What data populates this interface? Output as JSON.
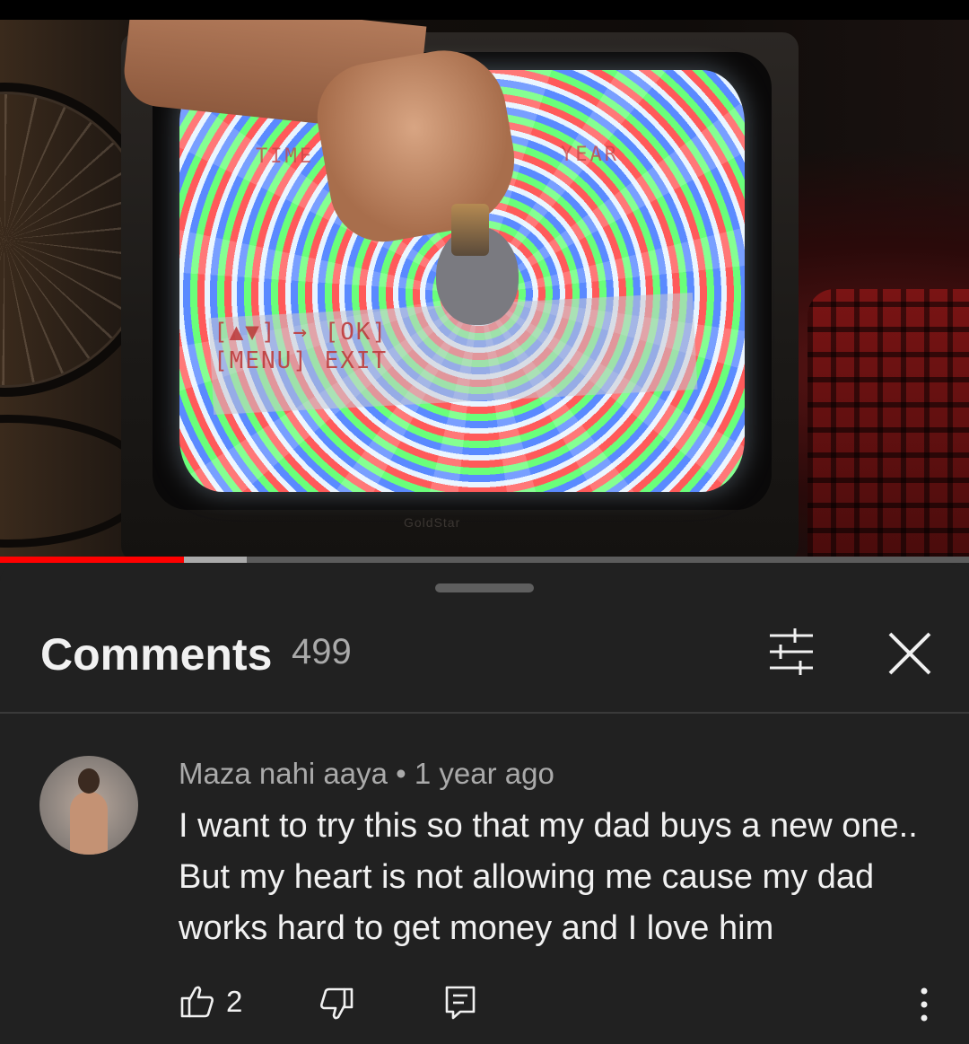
{
  "video": {
    "tv_osd": {
      "line1": "[▲▼] → [OK]",
      "line2": "[MENU] EXIT",
      "top_left": "TIME",
      "top_right": "YEAR"
    },
    "tv_brand": "GoldStar",
    "progress": {
      "played_fraction": 0.19,
      "buffered_fraction": 0.255
    }
  },
  "comments_panel": {
    "title": "Comments",
    "count": "499",
    "icons": {
      "filter": "sort-filter-icon",
      "close": "close-icon"
    }
  },
  "comment": {
    "author": "Maza nahi aaya",
    "separator": "•",
    "time": "1 year ago",
    "text": "I want to try this so that my dad buys a new one.. But my heart is not allowing me cause my dad works hard to get money and I love him",
    "likes": "2",
    "icons": {
      "like": "thumbs-up-icon",
      "dislike": "thumbs-down-icon",
      "reply": "reply-icon",
      "more": "more-vert-icon"
    }
  },
  "colors": {
    "background": "#212121",
    "text_primary": "#f1f1f1",
    "text_secondary": "#aaaaaa",
    "progress_played": "#ff0000"
  }
}
